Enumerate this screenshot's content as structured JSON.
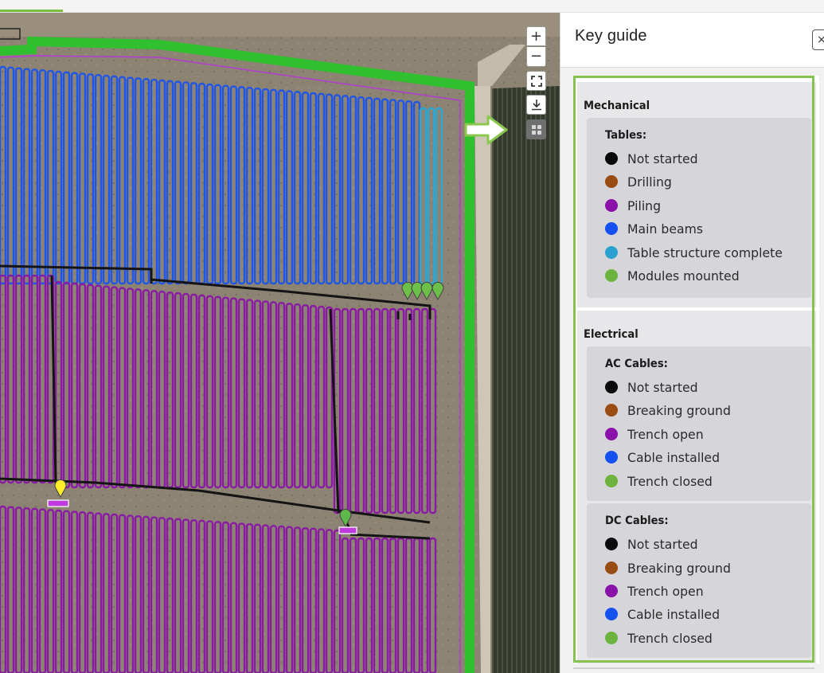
{
  "panel": {
    "title": "Key guide",
    "close_label": "×",
    "sections": [
      {
        "title": "Mechanical",
        "groups": [
          {
            "title": "Tables:",
            "items": [
              {
                "label": "Not started",
                "color": "#0a0a0a"
              },
              {
                "label": "Drilling",
                "color": "#9a4d12"
              },
              {
                "label": "Piling",
                "color": "#8b12a8"
              },
              {
                "label": "Main beams",
                "color": "#1550f0"
              },
              {
                "label": "Table structure complete",
                "color": "#2aa2cf"
              },
              {
                "label": "Modules mounted",
                "color": "#6cb33f"
              }
            ]
          }
        ]
      },
      {
        "title": "Electrical",
        "groups": [
          {
            "title": "AC Cables:",
            "items": [
              {
                "label": "Not started",
                "color": "#0a0a0a"
              },
              {
                "label": "Breaking ground",
                "color": "#9a4d12"
              },
              {
                "label": "Trench open",
                "color": "#8b12a8"
              },
              {
                "label": "Cable installed",
                "color": "#1550f0"
              },
              {
                "label": "Trench closed",
                "color": "#6cb33f"
              }
            ]
          },
          {
            "title": "DC Cables:",
            "items": [
              {
                "label": "Not started",
                "color": "#0a0a0a"
              },
              {
                "label": "Breaking ground",
                "color": "#9a4d12"
              },
              {
                "label": "Trench open",
                "color": "#8b12a8"
              },
              {
                "label": "Cable installed",
                "color": "#1550f0"
              },
              {
                "label": "Trench closed",
                "color": "#6cb33f"
              }
            ]
          }
        ]
      }
    ]
  },
  "map_controls": {
    "zoom_in": "+",
    "zoom_out": "−",
    "icons": [
      "plus-icon",
      "minus-icon",
      "fullscreen-icon",
      "download-icon",
      "layers-icon"
    ]
  },
  "map_colors": {
    "ground": "#8b8171",
    "field_dark": "#3c3f33",
    "perimeter": "#2fbf2f",
    "blue_tables": "#1f56e8",
    "cyan_tables": "#2aa8d6",
    "purple_tables": "#8a19a6",
    "cable": "#141414",
    "road": "#d9d3c3"
  },
  "annotation_color": "#8cc850"
}
